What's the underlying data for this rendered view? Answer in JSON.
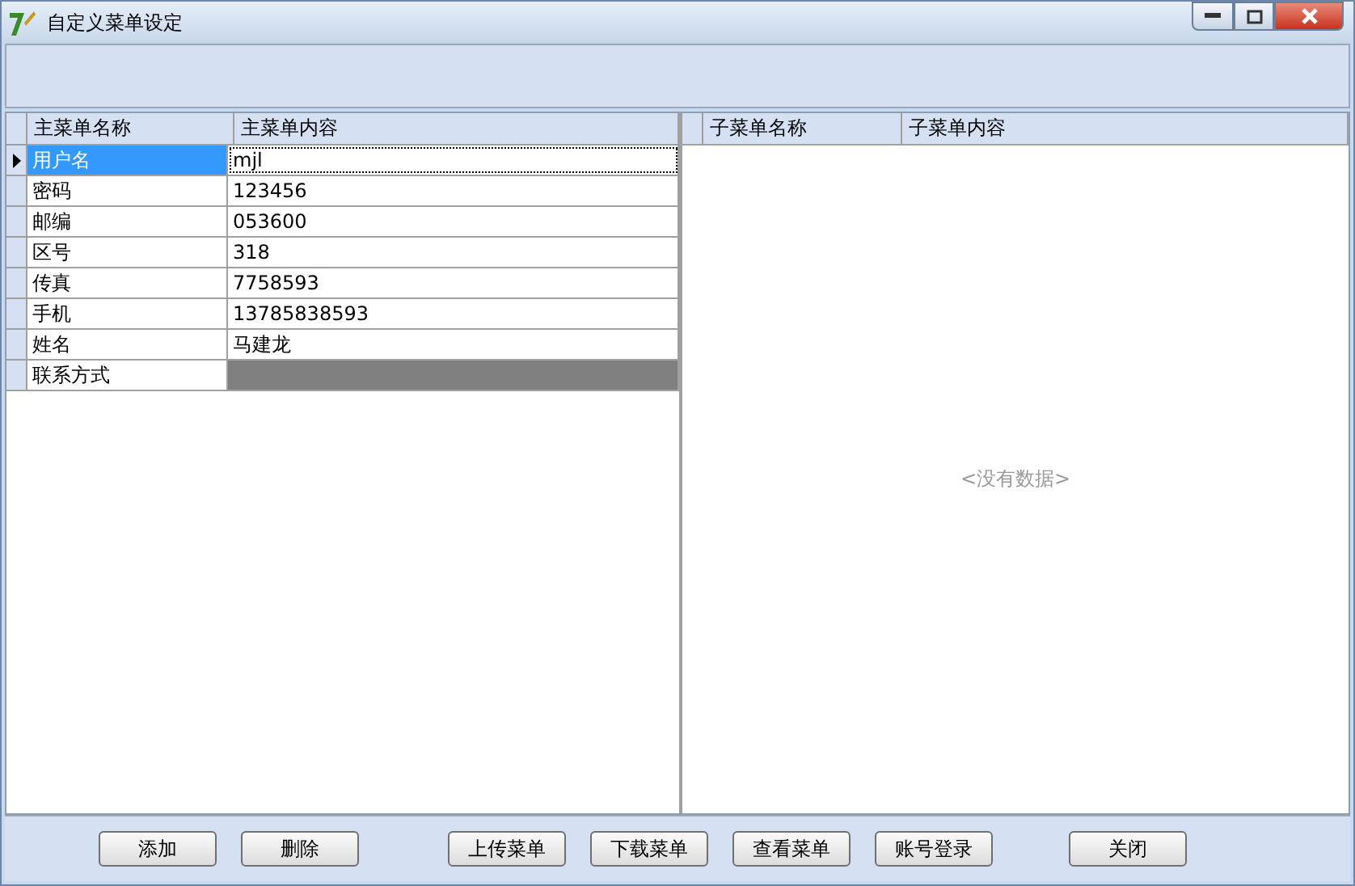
{
  "window": {
    "title": "自定义菜单设定"
  },
  "main_grid": {
    "columns": [
      "主菜单名称",
      "主菜单内容"
    ],
    "rows": [
      {
        "name": "用户名",
        "content": "mjl",
        "selected": true,
        "shaded": false
      },
      {
        "name": "密码",
        "content": "123456",
        "selected": false,
        "shaded": false
      },
      {
        "name": "邮编",
        "content": "053600",
        "selected": false,
        "shaded": false
      },
      {
        "name": "区号",
        "content": "318",
        "selected": false,
        "shaded": false
      },
      {
        "name": "传真",
        "content": "7758593",
        "selected": false,
        "shaded": false
      },
      {
        "name": "手机",
        "content": "13785838593",
        "selected": false,
        "shaded": false
      },
      {
        "name": "姓名",
        "content": "马建龙",
        "selected": false,
        "shaded": false
      },
      {
        "name": "联系方式",
        "selected": false,
        "shaded": true
      }
    ]
  },
  "sub_grid": {
    "columns": [
      "子菜单名称",
      "子菜单内容"
    ],
    "empty_text": "<没有数据>"
  },
  "buttons": [
    "添加",
    "删除",
    "上传菜单",
    "下载菜单",
    "查看菜单",
    "账号登录",
    "关闭"
  ]
}
